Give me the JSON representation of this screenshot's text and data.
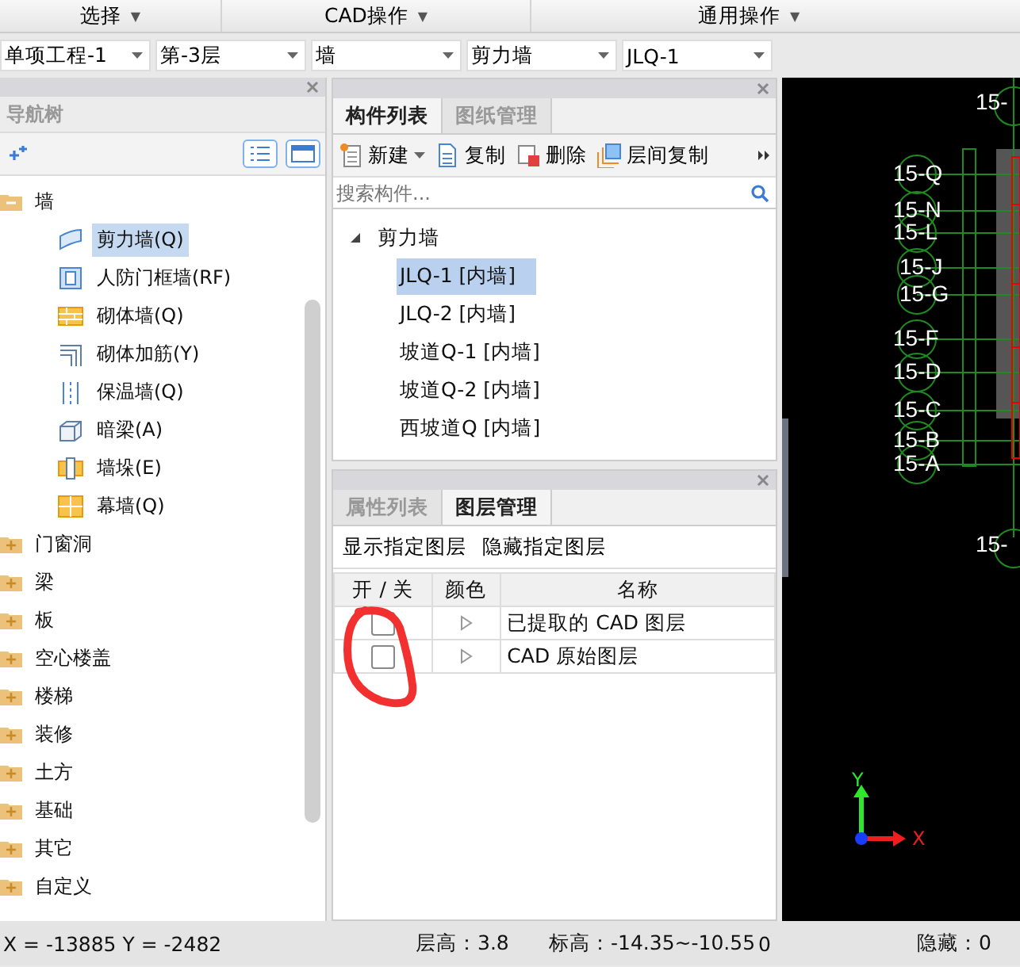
{
  "menu": [
    {
      "label": "选择",
      "caret": "▼"
    },
    {
      "label": "CAD操作",
      "caret": "▼"
    },
    {
      "label": "通用操作",
      "caret": "▼"
    }
  ],
  "combos": [
    "单项工程-1",
    "第-3层",
    "墙",
    "剪力墙",
    "JLQ-1"
  ],
  "nav": {
    "title": "导航树",
    "tree": [
      {
        "label": "墙",
        "expanded": true,
        "children": [
          {
            "label": "剪力墙(Q)",
            "kind": "shear",
            "selected": true
          },
          {
            "label": "人防门框墙(RF)",
            "kind": "frame",
            "selected": false
          },
          {
            "label": "砌体墙(Q)",
            "kind": "brick",
            "selected": false
          },
          {
            "label": "砌体加筋(Y)",
            "kind": "rebar",
            "selected": false
          },
          {
            "label": "保温墙(Q)",
            "kind": "insulation",
            "selected": false
          },
          {
            "label": "暗梁(A)",
            "kind": "beam",
            "selected": false
          },
          {
            "label": "墙垛(E)",
            "kind": "pier",
            "selected": false
          },
          {
            "label": "幕墙(Q)",
            "kind": "curtain",
            "selected": false
          }
        ]
      },
      {
        "label": "门窗洞",
        "expanded": false
      },
      {
        "label": "梁",
        "expanded": false
      },
      {
        "label": "板",
        "expanded": false
      },
      {
        "label": "空心楼盖",
        "expanded": false
      },
      {
        "label": "楼梯",
        "expanded": false
      },
      {
        "label": "装修",
        "expanded": false
      },
      {
        "label": "土方",
        "expanded": false
      },
      {
        "label": "基础",
        "expanded": false
      },
      {
        "label": "其它",
        "expanded": false
      },
      {
        "label": "自定义",
        "expanded": false
      }
    ]
  },
  "components": {
    "tabs": [
      {
        "label": "构件列表",
        "selected": true
      },
      {
        "label": "图纸管理",
        "selected": false
      }
    ],
    "toolbar": [
      {
        "label": "新建",
        "kind": "new"
      },
      {
        "label": "复制",
        "kind": "copy"
      },
      {
        "label": "删除",
        "kind": "delete"
      },
      {
        "label": "层间复制",
        "kind": "floor-copy"
      }
    ],
    "search": {
      "placeholder": "搜索构件..."
    },
    "tree": {
      "label": "剪力墙",
      "expanded": true,
      "children": [
        {
          "label": "JLQ-1 [内墙]",
          "selected": true
        },
        {
          "label": "JLQ-2 [内墙]",
          "selected": false
        },
        {
          "label": "坡道Q-1 [内墙]",
          "selected": false
        },
        {
          "label": "坡道Q-2 [内墙]",
          "selected": false
        },
        {
          "label": "西坡道Q [内墙]",
          "selected": false
        }
      ]
    }
  },
  "layers": {
    "tabs": [
      {
        "label": "属性列表",
        "selected": false
      },
      {
        "label": "图层管理",
        "selected": true
      }
    ],
    "actions": [
      "显示指定图层",
      "隐藏指定图层"
    ],
    "columns": [
      "开 / 关",
      "颜色",
      "名称"
    ],
    "rows": [
      {
        "on": false,
        "name": "已提取的 CAD 图层"
      },
      {
        "on": false,
        "name": "CAD 原始图层"
      }
    ]
  },
  "canvas": {
    "axis_labels": [
      "15-",
      "15-Q",
      "15-N",
      "15-L",
      "15-J",
      "15-G",
      "15-F",
      "15-D",
      "15-C",
      "15-B",
      "15-A",
      "15-"
    ],
    "x_label": "X",
    "y_label": "Y"
  },
  "status": {
    "coords": "X = -13885 Y = -2482",
    "floor_height": "层高：3.8",
    "elevation": "标高：-14.35~-10.55",
    "value": "0",
    "hidden": "隐藏：0"
  }
}
